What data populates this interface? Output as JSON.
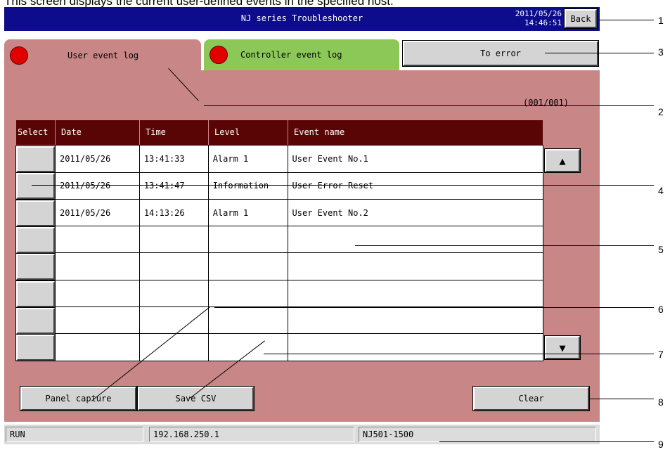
{
  "caption": "This screen displays the current user-defined events in the specified host.",
  "header": {
    "title": "NJ series Troubleshooter",
    "date": "2011/05/26",
    "time": "14:46:51",
    "back_label": "Back"
  },
  "tabs": {
    "user_event_log": "User event log",
    "controller_event_log": "Controller event log",
    "to_error": "To error"
  },
  "page_counter": "(001/001)",
  "table": {
    "columns": [
      "Select",
      "Date",
      "Time",
      "Level",
      "Event name"
    ],
    "rows": [
      {
        "date": "2011/05/26",
        "time": "13:41:33",
        "level": "Alarm 1",
        "event": "User Event No.1"
      },
      {
        "date": "2011/05/26",
        "time": "13:41:47",
        "level": "Information",
        "event": "User Error Reset"
      },
      {
        "date": "2011/05/26",
        "time": "14:13:26",
        "level": "Alarm 1",
        "event": "User Event No.2"
      },
      {
        "date": "",
        "time": "",
        "level": "",
        "event": ""
      },
      {
        "date": "",
        "time": "",
        "level": "",
        "event": ""
      },
      {
        "date": "",
        "time": "",
        "level": "",
        "event": ""
      },
      {
        "date": "",
        "time": "",
        "level": "",
        "event": ""
      },
      {
        "date": "",
        "time": "",
        "level": "",
        "event": ""
      }
    ]
  },
  "buttons": {
    "panel_capture": "Panel capture",
    "save_csv": "Save CSV",
    "clear": "Clear",
    "scroll_up": "▲",
    "scroll_down": "▼"
  },
  "status": {
    "mode": "RUN",
    "ip": "192.168.250.1",
    "model": "NJ501-1500"
  },
  "callouts": [
    "1",
    "2",
    "3",
    "4",
    "5",
    "6",
    "7",
    "8",
    "9"
  ],
  "colors": {
    "title_bar": "#0c0c8c",
    "panel": "#c98686",
    "header_row": "#5a0505",
    "controller_tab": "#8bc857",
    "indicator": "#e00000"
  }
}
